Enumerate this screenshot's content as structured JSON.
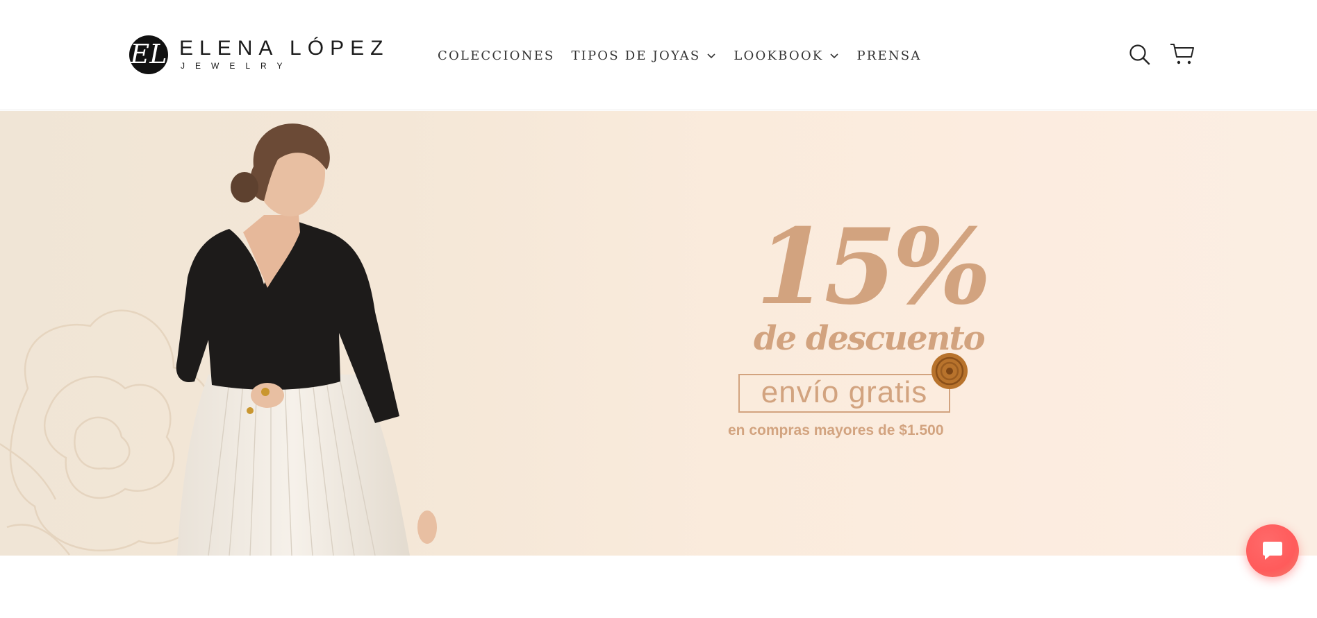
{
  "header": {
    "logo": {
      "monogram": "EL",
      "name": "ELENA LÓPEZ",
      "subtitle": "JEWELRY"
    },
    "nav": [
      {
        "label": "COLECCIONES",
        "has_dropdown": false
      },
      {
        "label": "TIPOS DE JOYAS",
        "has_dropdown": true
      },
      {
        "label": "LOOKBOOK",
        "has_dropdown": true
      },
      {
        "label": "PRENSA",
        "has_dropdown": false
      }
    ],
    "icons": [
      "search-icon",
      "cart-icon"
    ]
  },
  "hero": {
    "promo": {
      "discount": "15%",
      "discount_text": "de descuento",
      "shipping": "envío gratis",
      "condition": "en compras mayores de $1.500"
    }
  },
  "chat": {
    "icon": "chat-bubble-icon"
  },
  "colors": {
    "promo_text": "#d2a37f",
    "chat_button": "#ff5b5b",
    "hero_background": "#fbecde"
  }
}
